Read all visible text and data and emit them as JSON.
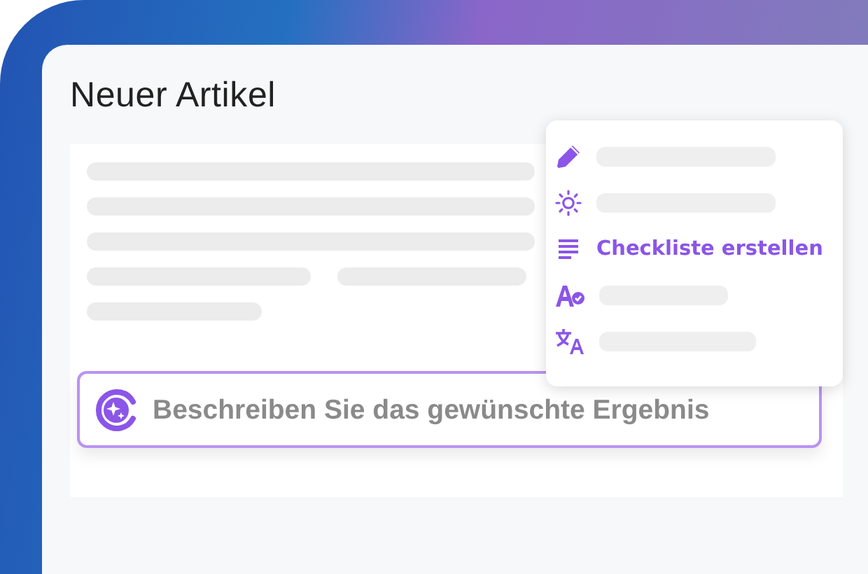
{
  "editor": {
    "title": "Neuer Artikel",
    "prompt": {
      "placeholder": "Beschreiben Sie das gewünschte Ergebnis"
    }
  },
  "menu": {
    "items": [
      {
        "kind": "loading"
      },
      {
        "kind": "loading"
      },
      {
        "kind": "label",
        "label": "Checkliste erstellen"
      },
      {
        "kind": "loading"
      },
      {
        "kind": "loading"
      }
    ]
  }
}
